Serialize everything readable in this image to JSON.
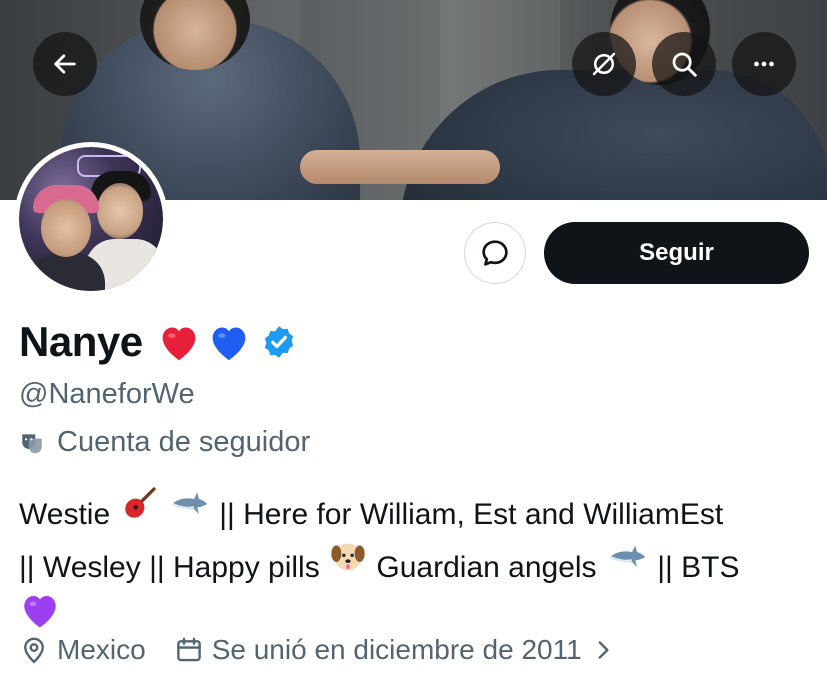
{
  "header": {
    "back_icon": "arrow-left-icon",
    "translate_icon": "translate-off-icon",
    "search_icon": "search-icon",
    "more_icon": "more-horizontal-icon"
  },
  "profile": {
    "name": "Nanye",
    "name_emojis": [
      "red-heart",
      "blue-heart"
    ],
    "verified": true,
    "handle": "@NaneforWe",
    "account_type": "Cuenta de seguidor",
    "bio_line1_a": "Westie",
    "bio_line1_b": "|| Here for William, Est and WilliamEst",
    "bio_line2_a": "|| Wesley || Happy pills",
    "bio_line2_b": "Guardian angels",
    "bio_line2_c": "|| BTS",
    "location": "Mexico",
    "joined": "Se unió en diciembre de 2011"
  },
  "actions": {
    "follow_label": "Seguir",
    "message_icon": "message-bubble-icon"
  },
  "colors": {
    "accent_dark": "#0f1419",
    "secondary_text": "#536471",
    "verified_blue": "#1d9bf0"
  }
}
